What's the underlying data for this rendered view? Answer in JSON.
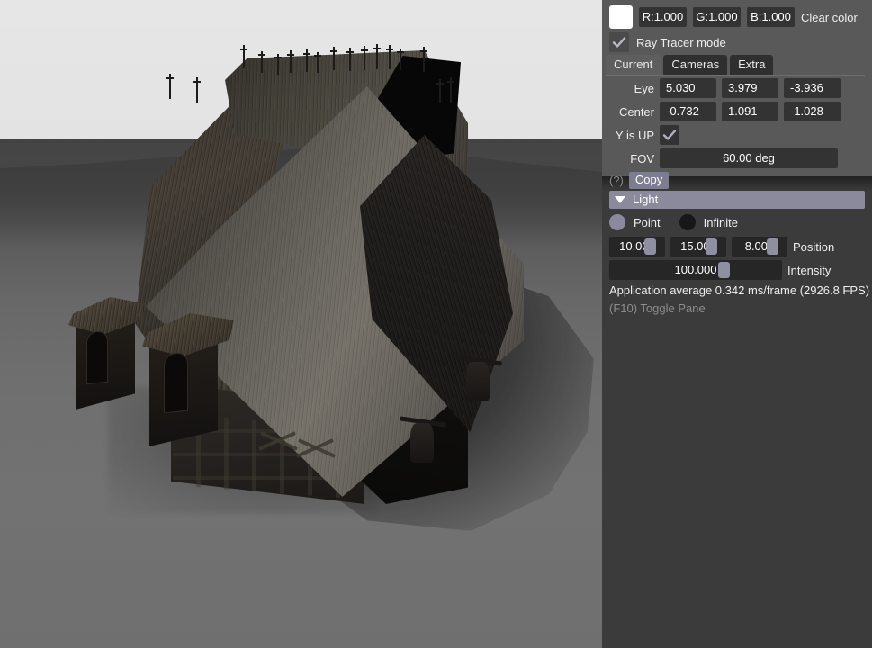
{
  "viewport": {
    "name": "3d-raytracer-viewport",
    "scene_description": "Dark half-timbered medieval house with steep shingled gable roof, ridge finials, two dormer windows and hanging sacks, on a gray ground plane under a pale sky",
    "sky_color": "#e4e4e4",
    "ground_color": "#6e6e6e",
    "ground_far_color": "#3b3b3b",
    "roof_lit_color": "#767269",
    "roof_shadow_color": "#332f2a",
    "wall_color": "#1b1916",
    "shadow_color": "#1a1a1a"
  },
  "panel": {
    "clear_color": {
      "swatch_color": "#ffffff",
      "r": "R:1.000",
      "g": "G:1.000",
      "b": "B:1.000",
      "label": "Clear color"
    },
    "ray_tracer_mode": {
      "label": "Ray Tracer mode",
      "checked": true
    },
    "tabs": [
      {
        "label": "Current",
        "active": true
      },
      {
        "label": "Cameras",
        "active": false
      },
      {
        "label": "Extra",
        "active": false
      }
    ],
    "camera": {
      "eye_label": "Eye",
      "eye": [
        "5.030",
        "3.979",
        "-3.936"
      ],
      "center_label": "Center",
      "center": [
        "-0.732",
        "1.091",
        "-1.028"
      ],
      "y_is_up_label": "Y is UP",
      "y_is_up": true,
      "fov_label": "FOV",
      "fov_value": "60.00 deg"
    },
    "help_marker": "(?)",
    "copy_button": "Copy",
    "light": {
      "header": "Light",
      "collapsed": false,
      "type_options": [
        {
          "label": "Point",
          "selected": true
        },
        {
          "label": "Infinite",
          "selected": false
        }
      ],
      "position_label": "Position",
      "position": [
        "10.000",
        "15.000",
        "8.000"
      ],
      "position_grab_pct": [
        72,
        72,
        72
      ],
      "intensity_label": "Intensity",
      "intensity": "100.000",
      "intensity_grab_pct": 63
    },
    "status": {
      "fps_line": "Application average 0.342 ms/frame (2926.8 FPS)",
      "toggle_hint": "(F10) Toggle Pane"
    }
  }
}
